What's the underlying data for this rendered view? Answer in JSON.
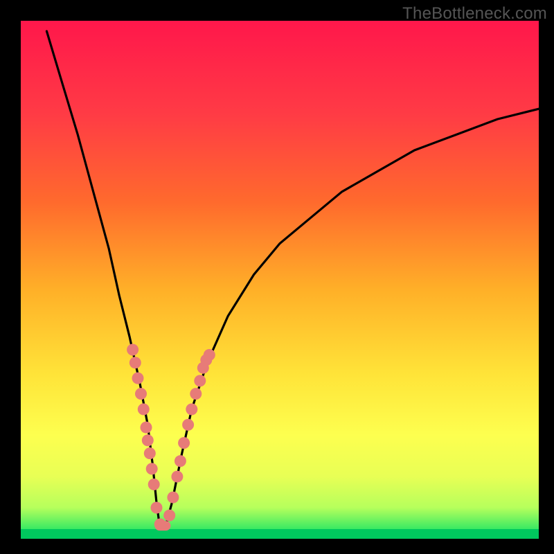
{
  "watermark": "TheBottleneck.com",
  "chart_data": {
    "type": "line",
    "title": "",
    "xlabel": "",
    "ylabel": "",
    "xlim": [
      0,
      100
    ],
    "ylim": [
      0,
      100
    ],
    "series": [
      {
        "name": "curve",
        "x": [
          5,
          8,
          11,
          14,
          17,
          19,
          21,
          23,
          24.5,
          25.5,
          26.2,
          26.8,
          28.0,
          29.2,
          31,
          33,
          36,
          40,
          45,
          50,
          56,
          62,
          69,
          76,
          84,
          92,
          100
        ],
        "y": [
          98,
          88,
          78,
          67,
          56,
          47,
          39,
          30,
          22,
          14,
          7,
          2.5,
          2.5,
          7,
          16,
          25,
          34,
          43,
          51,
          57,
          62,
          67,
          71,
          75,
          78,
          81,
          83
        ]
      },
      {
        "name": "left-dots",
        "x": [
          21.6,
          22.1,
          22.6,
          23.2,
          23.7,
          24.2,
          24.5,
          24.9,
          25.3,
          25.7,
          26.2,
          26.9
        ],
        "y": [
          36.5,
          34.0,
          31.0,
          28.0,
          25.0,
          21.5,
          19.0,
          16.5,
          13.5,
          10.5,
          6.0,
          2.8
        ]
      },
      {
        "name": "right-dots",
        "x": [
          28.7,
          29.4,
          30.2,
          30.8,
          31.5,
          32.3,
          33.0,
          33.8,
          34.6,
          35.2,
          35.8,
          36.4
        ],
        "y": [
          4.5,
          8.0,
          12.0,
          15.0,
          18.5,
          22.0,
          25.0,
          28.0,
          30.5,
          33.0,
          34.5,
          35.5
        ]
      },
      {
        "name": "bottom-segment",
        "x": [
          26.8,
          28.0
        ],
        "y": [
          2.5,
          2.5
        ]
      }
    ],
    "grid": false,
    "background_gradient": [
      "#ff174b",
      "#ff6a2d",
      "#ffb028",
      "#ffe338",
      "#fdff4f",
      "#b6ff5c",
      "#00e066"
    ],
    "bottom_band_color": "#00c85e"
  }
}
